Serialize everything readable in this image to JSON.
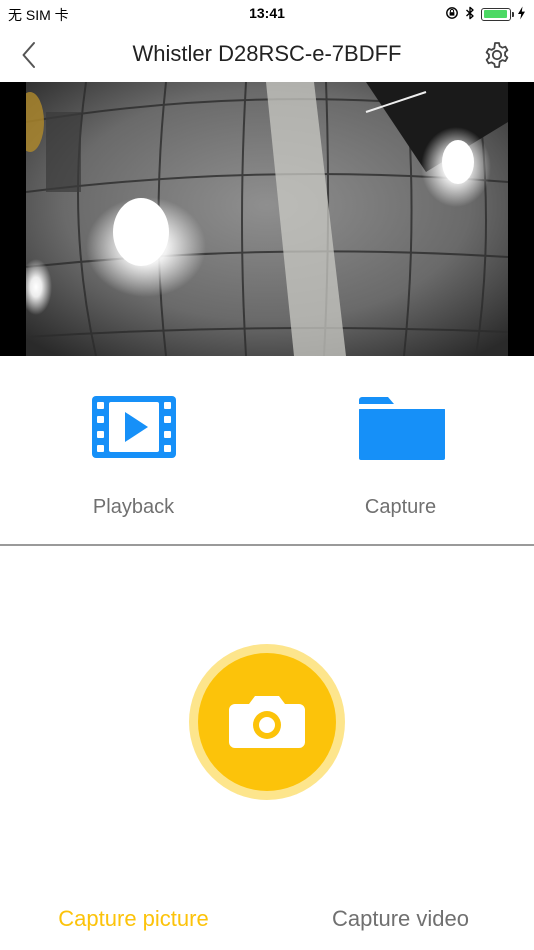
{
  "status_bar": {
    "carrier": "无 SIM 卡",
    "time": "13:41",
    "battery_level": 0.95
  },
  "nav": {
    "title": "Whistler D28RSC-e-7BDFF",
    "back_icon": "chevron-left-icon",
    "settings_icon": "gear-icon"
  },
  "functions": [
    {
      "label": "Playback",
      "icon": "video-file-icon"
    },
    {
      "label": "Capture",
      "icon": "folder-icon"
    }
  ],
  "shutter": {
    "icon": "camera-icon"
  },
  "modes": [
    {
      "label": "Capture picture",
      "active": true
    },
    {
      "label": "Capture video",
      "active": false
    }
  ],
  "colors": {
    "accent": "#fcc30a",
    "accent_ring": "#fde58c",
    "icon_blue": "#1690f8",
    "muted_text": "#707070",
    "battery_green": "#4cd964"
  }
}
